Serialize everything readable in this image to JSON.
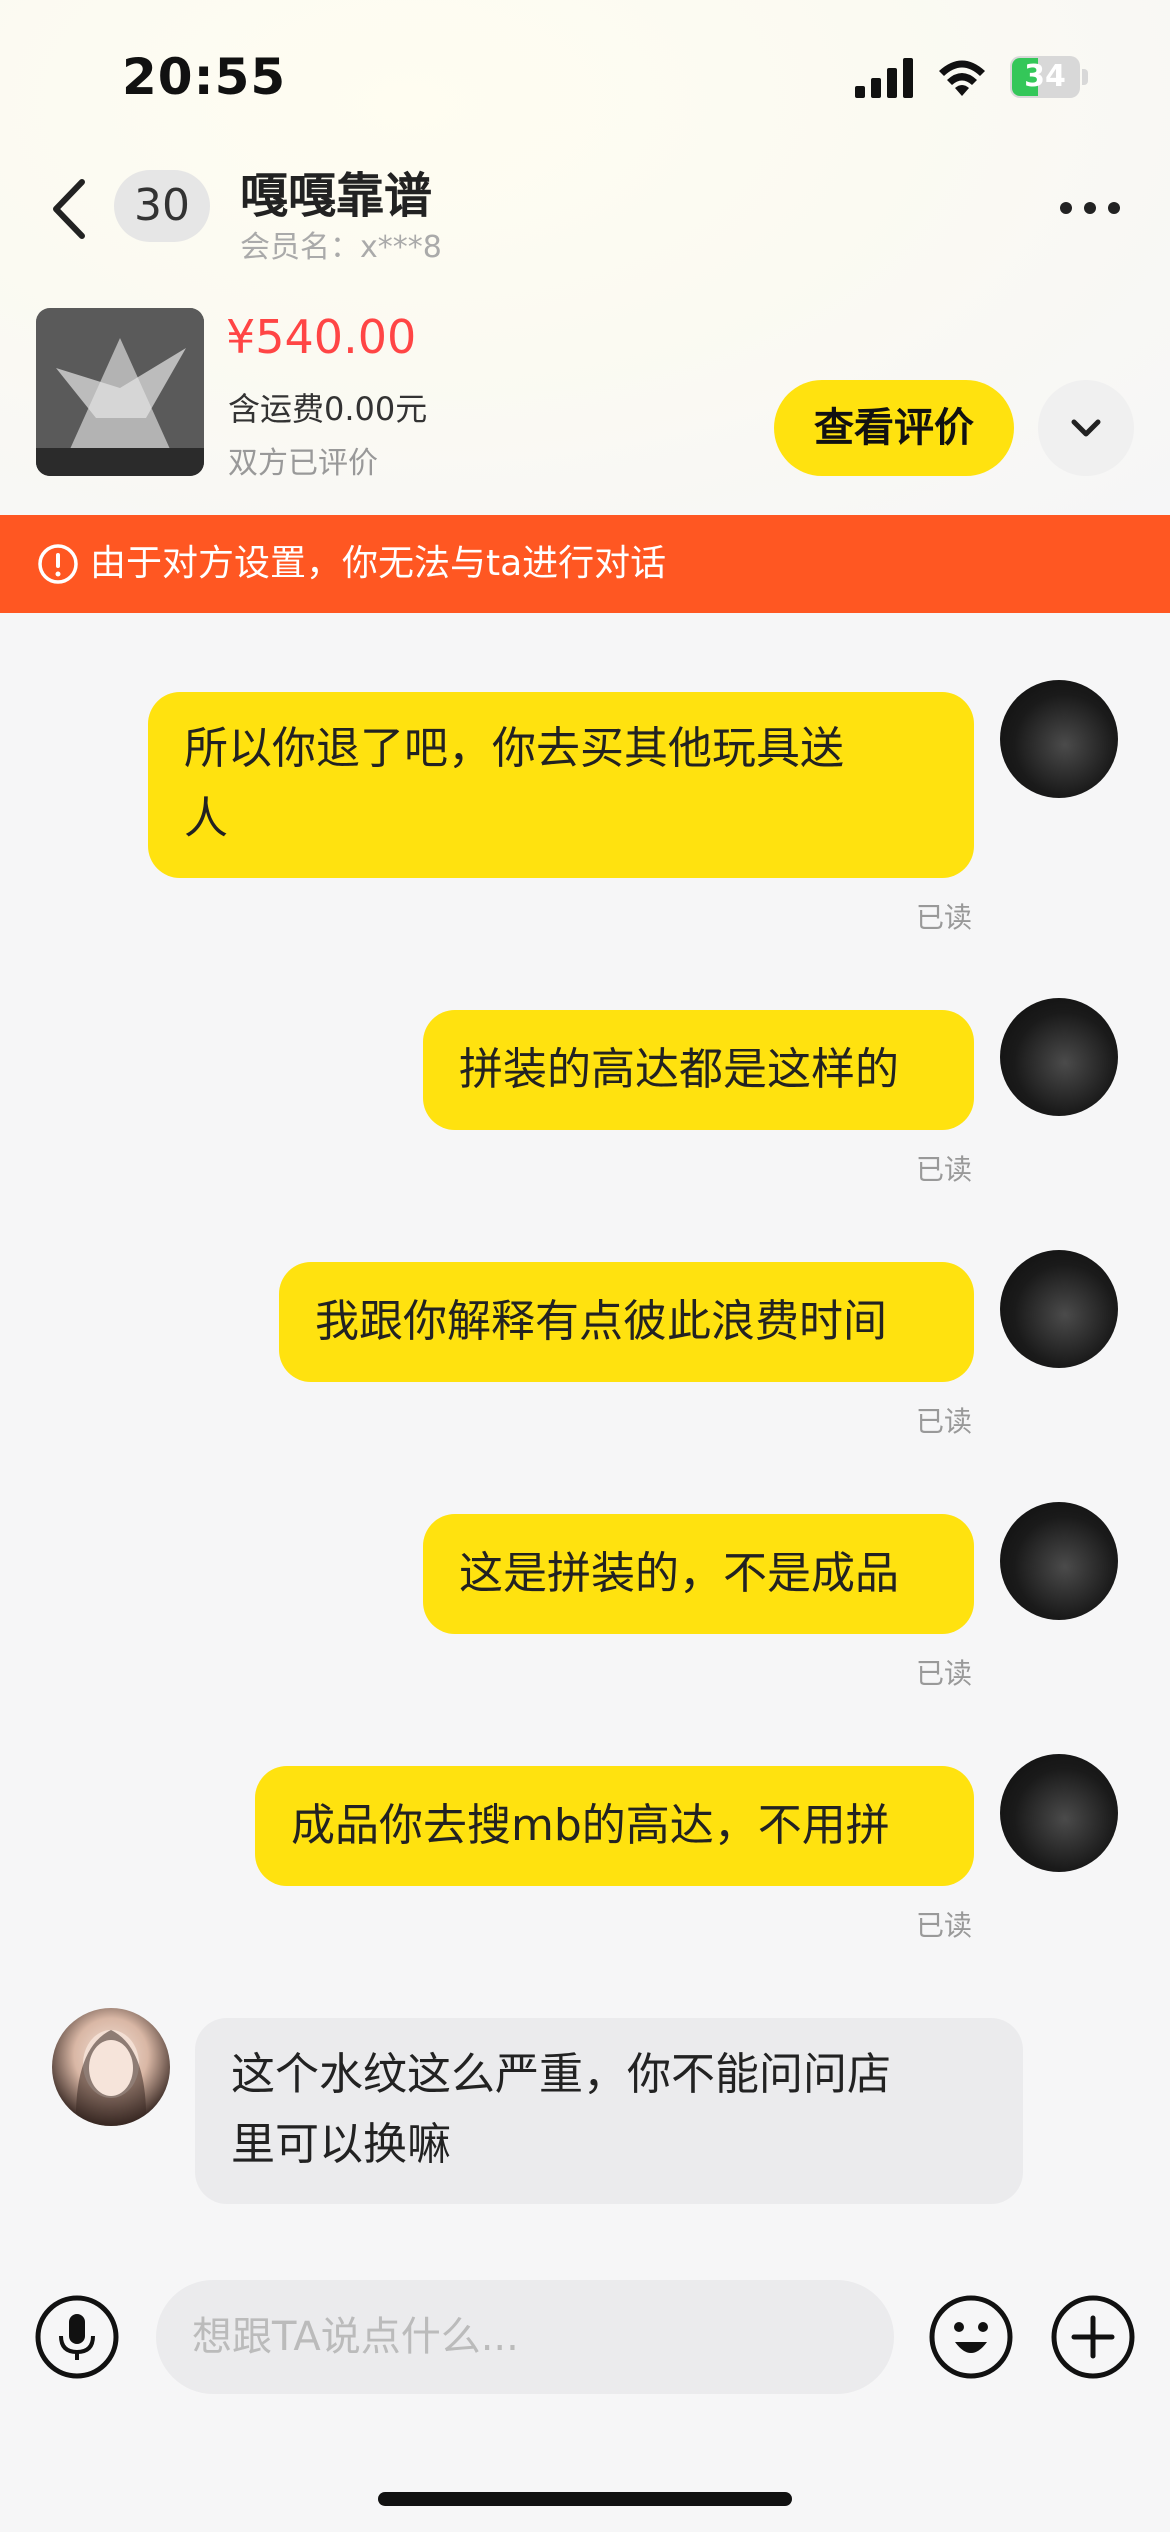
{
  "status_bar": {
    "time": "20:55",
    "battery": "34"
  },
  "header": {
    "unread_count": "30",
    "shop_name": "嘎嘎靠谱",
    "member_name": "会员名：x***8"
  },
  "product": {
    "price": "¥540.00",
    "shipping": "含运费0.00元",
    "review_status": "双方已评价",
    "review_button": "查看评价"
  },
  "warning": {
    "text": "由于对方设置，你无法与ta进行对话"
  },
  "messages": [
    {
      "from": "me",
      "text_line1": "所以你退了吧，你去买其他玩具送",
      "text_line2": "人",
      "status": "已读"
    },
    {
      "from": "me",
      "text": "拼装的高达都是这样的",
      "status": "已读"
    },
    {
      "from": "me",
      "text": "我跟你解释有点彼此浪费时间",
      "status": "已读"
    },
    {
      "from": "me",
      "text": "这是拼装的，不是成品",
      "status": "已读"
    },
    {
      "from": "me",
      "text": "成品你去搜mb的高达，不用拼",
      "status": "已读"
    },
    {
      "from": "them",
      "text_line1": "这个水纹这么严重，你不能问问店",
      "text_line2": "里可以换嘛"
    }
  ],
  "input": {
    "placeholder": "想跟TA说点什么..."
  },
  "colors": {
    "accent_yellow": "#ffe20f",
    "warning_orange": "#ff5722",
    "price_red": "#ff4545"
  }
}
